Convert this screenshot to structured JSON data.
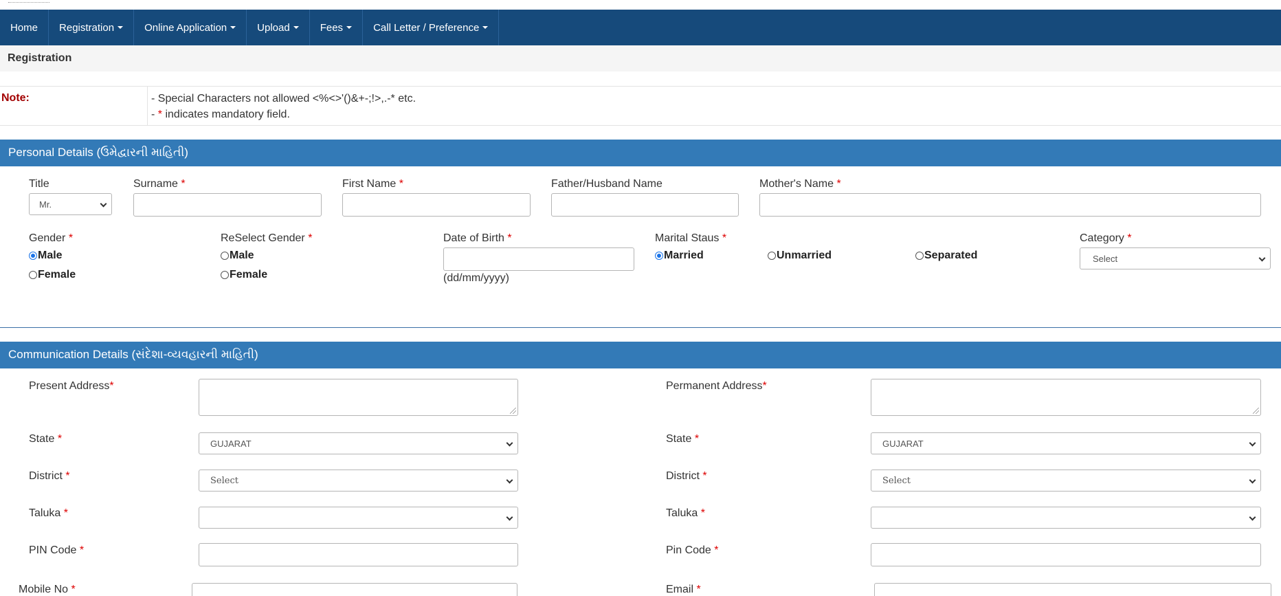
{
  "nav": {
    "items": [
      {
        "label": "Home",
        "has_caret": false
      },
      {
        "label": "Registration",
        "has_caret": true
      },
      {
        "label": "Online Application",
        "has_caret": true
      },
      {
        "label": "Upload",
        "has_caret": true
      },
      {
        "label": "Fees",
        "has_caret": true
      },
      {
        "label": "Call Letter / Preference",
        "has_caret": true
      }
    ]
  },
  "page": {
    "title": "Registration"
  },
  "note": {
    "label": "Note:",
    "line1": "- Special Characters not allowed <%<>'()&+-;!>,.-* etc.",
    "line2_prefix": "- ",
    "line2_star": "*",
    "line2_rest": " indicates mandatory field."
  },
  "required_mark": "*",
  "personal": {
    "heading": "Personal Details (ઉમેદ્વારની માહિતી)",
    "title_label": "Title",
    "title_value": "Mr.",
    "surname_label": "Surname",
    "firstname_label": "First Name",
    "father_label": "Father/Husband Name",
    "mother_label": "Mother's Name",
    "gender_label": "Gender",
    "gender_male": "Male",
    "gender_female": "Female",
    "regender_label": "ReSelect Gender",
    "regender_male": "Male",
    "regender_female": "Female",
    "dob_label": "Date of Birth",
    "dob_hint": "(dd/mm/yyyy)",
    "marital_label": "Marital Staus",
    "marital_married": "Married",
    "marital_unmarried": "Unmarried",
    "marital_separated": "Separated",
    "category_label": "Category",
    "category_value": "Select"
  },
  "communication": {
    "heading": "Communication Details (સંદેશા-વ્યવહારની માહિતી)",
    "present_address_label": "Present Address",
    "permanent_address_label": "Permanent Address",
    "state_label": "State",
    "state_value": "GUJARAT",
    "perm_state_label": "State",
    "perm_state_value": "GUJARAT",
    "district_label": "District",
    "district_value": "Select",
    "perm_district_label": "District",
    "perm_district_value": "Select",
    "taluka_label": "Taluka",
    "perm_taluka_label": "Taluka",
    "pin_label": "PIN Code",
    "perm_pin_label": "Pin Code",
    "mobile_label": "Mobile No",
    "email_label": "Email"
  },
  "colors": {
    "navbar": "#164a7b",
    "section": "#337ab7",
    "required": "#dd0000",
    "note_label": "#a30000"
  }
}
